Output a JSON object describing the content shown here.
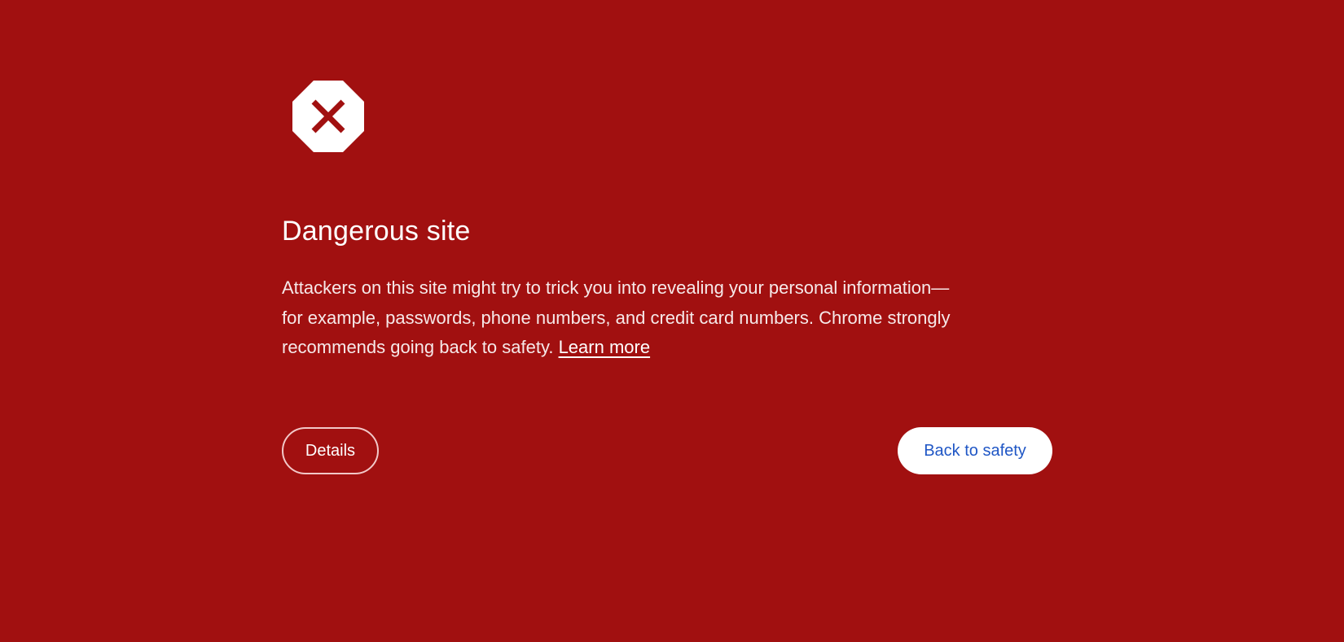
{
  "page": {
    "background_color": "#a11010"
  },
  "warning": {
    "icon": "stop-octagon-x-icon",
    "title": "Dangerous site",
    "body_lines": [
      "Attackers on this site might try to trick you into revealing your personal information—",
      "for example, passwords, phone numbers, and credit card numbers. Chrome strongly",
      "recommends going back to safety."
    ],
    "learn_more_label": "Learn more"
  },
  "actions": {
    "details_label": "Details",
    "back_label": "Back to safety",
    "back_text_color": "#1f56c5"
  }
}
